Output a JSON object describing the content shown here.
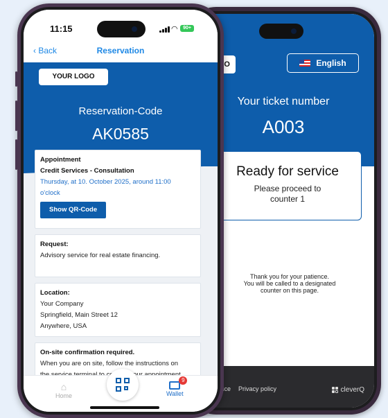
{
  "back_phone": {
    "logo_text": "UR LOGO",
    "language_label": "English",
    "ticket_label": "Your ticket number",
    "ticket_number": "A003",
    "status_title": "Ready for service",
    "status_line1": "Please proceed to",
    "status_line2": "counter 1",
    "patience_line1": "Thank you for your patience.",
    "patience_line2": "You will be called to a designated",
    "patience_line3": "counter on this page.",
    "footer_notice": "otice",
    "footer_privacy": "Privacy policy",
    "footer_brand": "cleverQ"
  },
  "front_phone": {
    "status_time": "11:15",
    "battery": "90+",
    "nav_back": "Back",
    "nav_title": "Reservation",
    "logo_text": "YOUR LOGO",
    "reservation_label": "Reservation-Code",
    "reservation_code": "AK0585",
    "appointment": {
      "heading": "Appointment",
      "service": "Credit Services - Consultation",
      "datetime_line1": "Thursday, at 10. October 2025, around 11:00",
      "datetime_line2": "o'clock",
      "qr_button": "Show QR-Code"
    },
    "request": {
      "heading": "Request:",
      "text": "Advisory service for real estate financing."
    },
    "location": {
      "heading": "Location:",
      "line1": "Your Company",
      "line2": "Springfield, Main Street 12",
      "line3": "Anywhere, USA"
    },
    "onsite": {
      "heading": "On-site confirmation required.",
      "line1": "When you are on site, follow the instructions on",
      "line2": "the service terminal to confirm your appointment"
    },
    "tabs": {
      "home": "Home",
      "wallet": "Wallet",
      "wallet_badge": "9"
    }
  },
  "colors": {
    "brand_blue": "#0e5dab",
    "link_blue": "#1e88e5",
    "background": "#e8f0fa"
  }
}
